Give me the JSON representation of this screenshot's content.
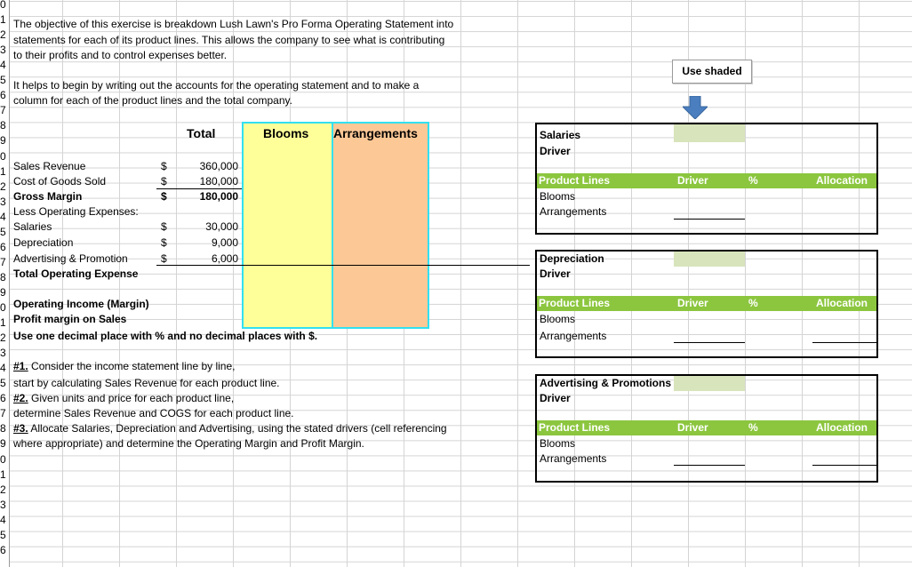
{
  "row_numbers": [
    "0",
    "1",
    "2",
    "3",
    "4",
    "5",
    "6",
    "7",
    "8",
    "9",
    "0",
    "1",
    "2",
    "3",
    "4",
    "5",
    "6",
    "7",
    "8",
    "9",
    "0",
    "1",
    "2",
    "3",
    "4",
    "5",
    "6",
    "7",
    "8",
    "9",
    "0",
    "1",
    "2",
    "3",
    "4",
    "5",
    "6"
  ],
  "intro": {
    "line1": "The objective of this exercise is breakdown Lush Lawn's Pro Forma Operating Statement into",
    "line2": "statements for each of its product lines. This allows the company to see what is contributing",
    "line3": "to their profits and to control expenses better.",
    "line5": "It helps to begin by writing out the accounts for the operating statement and to make a",
    "line6": "column for each of the product lines and the total company."
  },
  "headers": {
    "total": "Total",
    "blooms": "Blooms",
    "arrangements": "Arrangements"
  },
  "statement": {
    "sales_revenue": {
      "label": "Sales Revenue",
      "currency": "$",
      "value": "360,000"
    },
    "cogs": {
      "label": "Cost of Goods Sold",
      "currency": "$",
      "value": "180,000"
    },
    "gross_margin": {
      "label": "Gross Margin",
      "currency": "$",
      "value": "180,000"
    },
    "less_opex": "Less Operating Expenses:",
    "salaries": {
      "label": "Salaries",
      "currency": "$",
      "value": "30,000"
    },
    "depreciation": {
      "label": "Depreciation",
      "currency": "$",
      "value": "9,000"
    },
    "advertising": {
      "label": "Advertising & Promotion",
      "currency": "$",
      "value": "6,000"
    },
    "total_opex": "Total Operating Expense",
    "operating_income": "Operating Income (Margin)",
    "profit_margin": "Profit margin on Sales",
    "decimal_note": "Use one decimal place with % and no decimal places with $."
  },
  "instructions": {
    "step1_tag": "#1.",
    "step1_text": " Consider the income statement line by line,",
    "step1_text2": "start by calculating Sales Revenue for each product line.",
    "step2_tag": "#2.",
    "step2_text": " Given units and price for each product line,",
    "step2_text2": "determine Sales Revenue and COGS for each product line.",
    "step3_tag": "#3.",
    "step3_text": " Allocate Salaries, Depreciation and Advertising, using the stated drivers (cell referencing",
    "step3_text2": "where appropriate) and determine the Operating Margin and Profit Margin."
  },
  "use_shaded": "Use shaded",
  "allocation_tables": [
    {
      "title": "Salaries",
      "driver_label": "Driver",
      "col_product_lines": "Product Lines",
      "col_driver": "Driver",
      "col_pct": "%",
      "col_allocation": "Allocation",
      "row1": "Blooms",
      "row2": "Arrangements"
    },
    {
      "title": "Depreciation",
      "driver_label": "Driver",
      "col_product_lines": "Product Lines",
      "col_driver": "Driver",
      "col_pct": "%",
      "col_allocation": "Allocation",
      "row1": "Blooms",
      "row2": "Arrangements"
    },
    {
      "title": "Advertising & Promotions",
      "driver_label": "Driver",
      "col_product_lines": "Product Lines",
      "col_driver": "Driver",
      "col_pct": "%",
      "col_allocation": "Allocation",
      "row1": "Blooms",
      "row2": "Arrangements"
    }
  ],
  "colors": {
    "blooms_col": "#ffff99",
    "arrangements_col": "#fcc896",
    "header_border": "#33e0f0",
    "green_bar": "#8cc63f",
    "shade": "#d8e4bc",
    "arrow": "#4a7ebf"
  }
}
